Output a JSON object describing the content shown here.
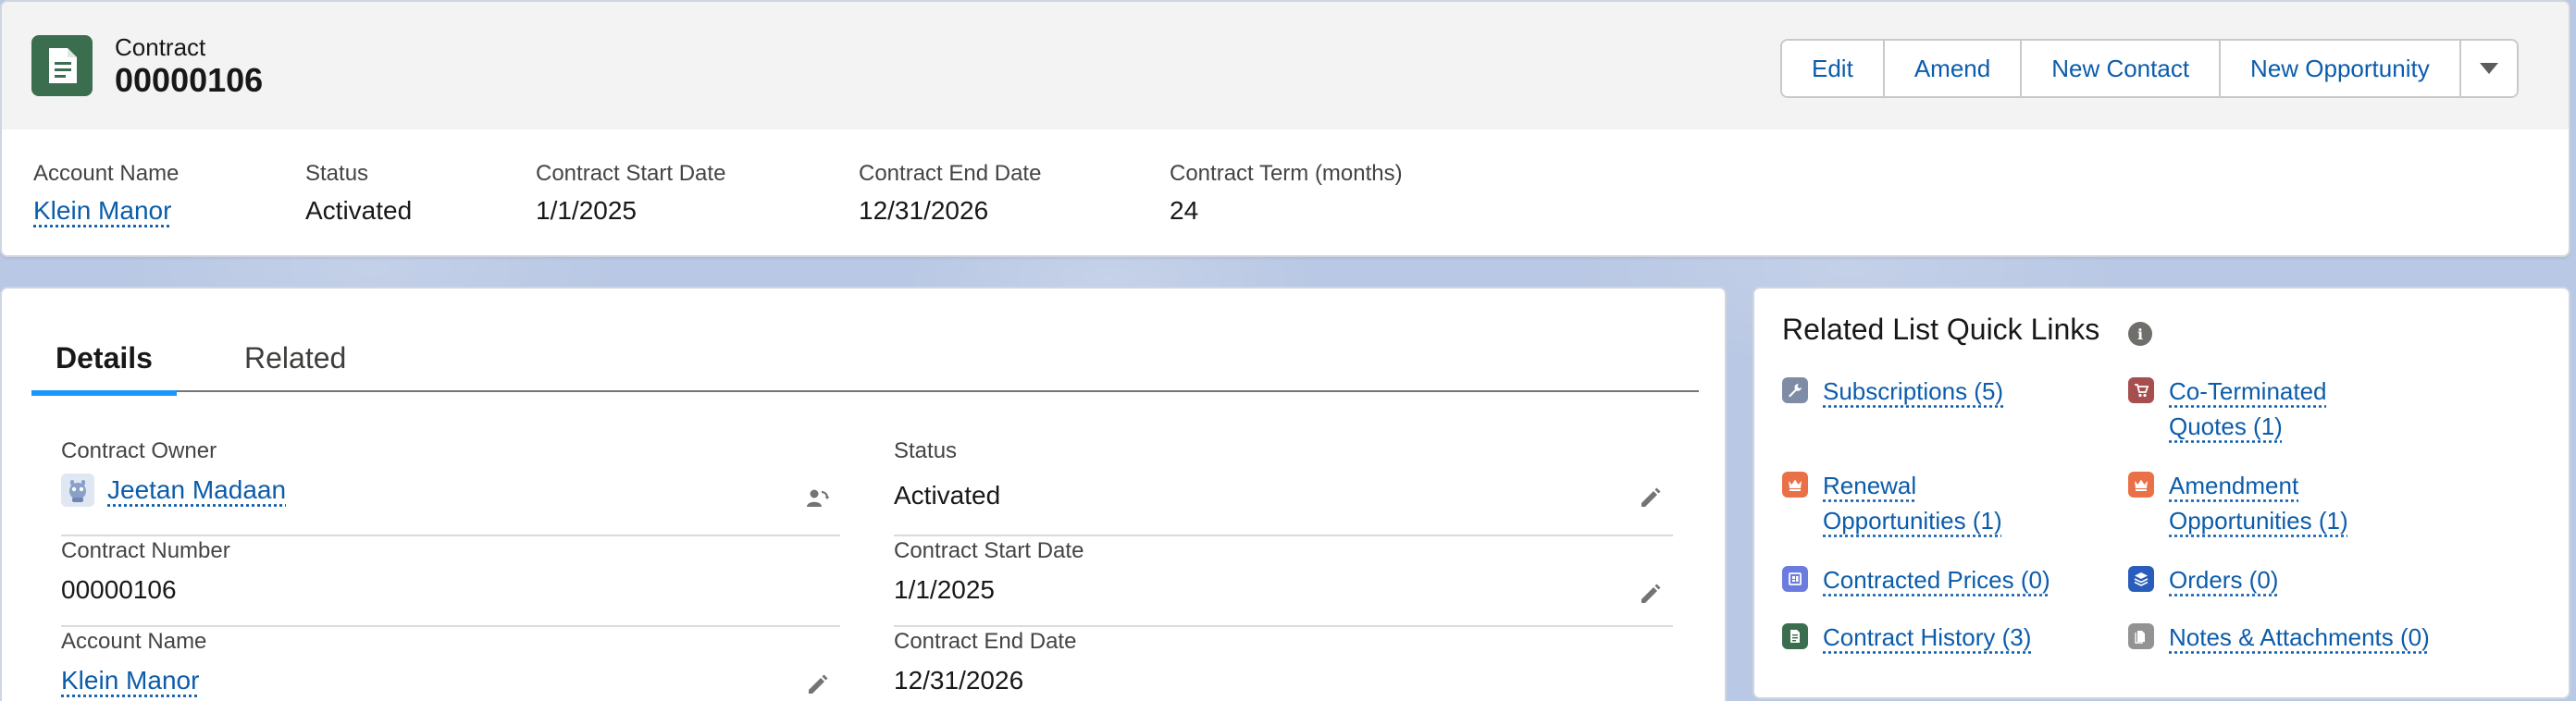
{
  "header": {
    "record_type": "Contract",
    "record_name": "00000106",
    "actions": {
      "edit": "Edit",
      "amend": "Amend",
      "new_contact": "New Contact",
      "new_opportunity": "New Opportunity"
    },
    "highlights": {
      "account_name": {
        "label": "Account Name",
        "value": "Klein Manor"
      },
      "status": {
        "label": "Status",
        "value": "Activated"
      },
      "start_date": {
        "label": "Contract Start Date",
        "value": "1/1/2025"
      },
      "end_date": {
        "label": "Contract End Date",
        "value": "12/31/2026"
      },
      "term": {
        "label": "Contract Term (months)",
        "value": "24"
      }
    }
  },
  "tabs": {
    "details": "Details",
    "related": "Related"
  },
  "details": {
    "contract_owner": {
      "label": "Contract Owner",
      "value": "Jeetan Madaan"
    },
    "status": {
      "label": "Status",
      "value": "Activated"
    },
    "contract_number": {
      "label": "Contract Number",
      "value": "00000106"
    },
    "start_date": {
      "label": "Contract Start Date",
      "value": "1/1/2025"
    },
    "account_name": {
      "label": "Account Name",
      "value": "Klein Manor"
    },
    "end_date": {
      "label": "Contract End Date",
      "value": "12/31/2026"
    }
  },
  "quick_links": {
    "title": "Related List Quick Links",
    "items": {
      "subscriptions": {
        "text": "Subscriptions (5)",
        "icon": "wrench-icon",
        "color": "#7f8ca6"
      },
      "co_terminated_quotes": {
        "line1": "Co-Terminated",
        "line2": "Quotes (1)",
        "icon": "cart-icon",
        "color": "#a74e4e"
      },
      "renewal_opportunities": {
        "line1": "Renewal",
        "line2": "Opportunities (1)",
        "icon": "crown-icon",
        "color": "#ea7048"
      },
      "amendment_opportunities": {
        "line1": "Amendment",
        "line2": "Opportunities (1)",
        "icon": "crown-icon",
        "color": "#ea7048"
      },
      "contracted_prices": {
        "text": "Contracted Prices (0)",
        "icon": "price-book-icon",
        "color": "#6b7be0"
      },
      "orders": {
        "text": "Orders (0)",
        "icon": "orders-icon",
        "color": "#2a5dbb"
      },
      "contract_history": {
        "text": "Contract History (3)",
        "icon": "contract-icon",
        "color": "#3b6e4f"
      },
      "notes_attachments": {
        "text": "Notes & Attachments (0)",
        "icon": "file-icon",
        "color": "#939393"
      }
    }
  },
  "colors": {
    "link": "#0b5cab",
    "brand_contract": "#3b6e4f",
    "tab_active_indicator": "#1b96ff"
  }
}
